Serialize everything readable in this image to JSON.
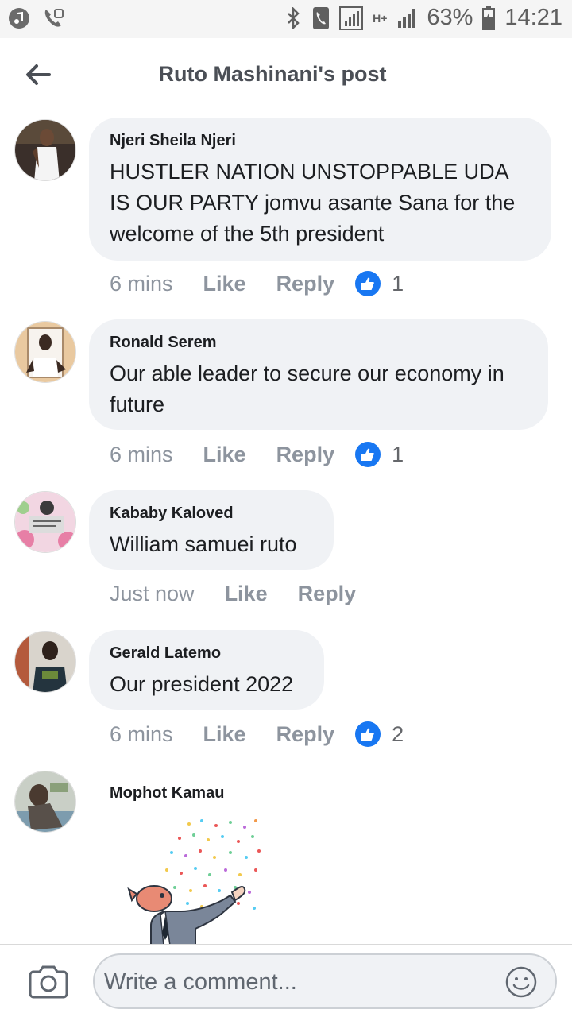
{
  "status_bar": {
    "battery": "63%",
    "time": "14:21",
    "network": "H+"
  },
  "header": {
    "title": "Ruto Mashinani's post"
  },
  "comments": [
    {
      "author": "Njeri Sheila Njeri",
      "text": "HUSTLER NATION UNSTOPPABLE UDA IS OUR PARTY jomvu asante Sana for the welcome of the 5th president",
      "time": "6 mins",
      "like_label": "Like",
      "reply_label": "Reply",
      "likes": "1"
    },
    {
      "author": "Ronald Serem",
      "text": "Our able leader to secure our economy in future",
      "time": "6 mins",
      "like_label": "Like",
      "reply_label": "Reply",
      "likes": "1"
    },
    {
      "author": "Kababy Kaloved",
      "text": "William samuei ruto",
      "time": "Just now",
      "like_label": "Like",
      "reply_label": "Reply",
      "likes": ""
    },
    {
      "author": "Gerald Latemo",
      "text": "Our president 2022",
      "time": "6 mins",
      "like_label": "Like",
      "reply_label": "Reply",
      "likes": "2"
    },
    {
      "author": "Mophot Kamau",
      "text": "",
      "time": "",
      "like_label": "",
      "reply_label": "",
      "likes": ""
    }
  ],
  "composer": {
    "placeholder": "Write a comment..."
  },
  "colors": {
    "accent": "#1877f2",
    "bubble": "#f0f2f5",
    "meta_text": "#8d949e"
  }
}
